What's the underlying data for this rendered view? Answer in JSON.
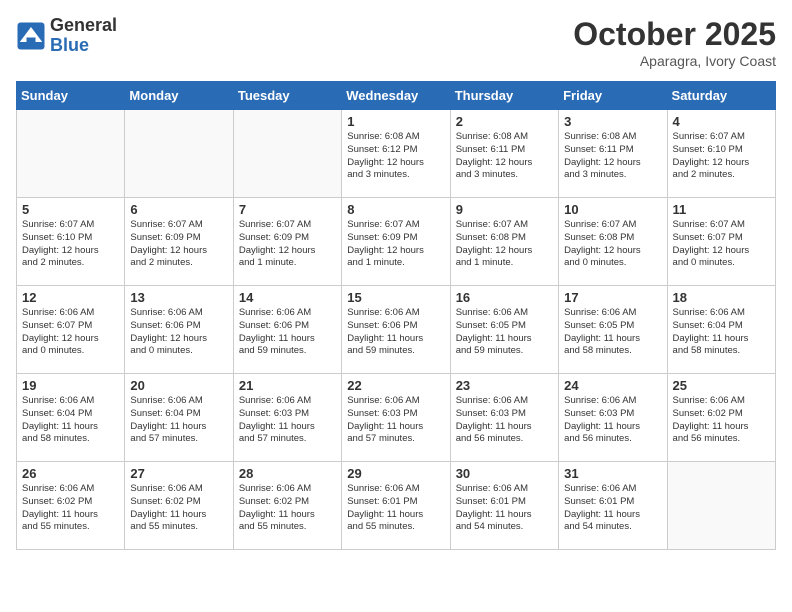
{
  "header": {
    "logo_line1": "General",
    "logo_line2": "Blue",
    "month": "October 2025",
    "location": "Aparagra, Ivory Coast"
  },
  "days_of_week": [
    "Sunday",
    "Monday",
    "Tuesday",
    "Wednesday",
    "Thursday",
    "Friday",
    "Saturday"
  ],
  "weeks": [
    [
      {
        "day": "",
        "info": ""
      },
      {
        "day": "",
        "info": ""
      },
      {
        "day": "",
        "info": ""
      },
      {
        "day": "1",
        "info": "Sunrise: 6:08 AM\nSunset: 6:12 PM\nDaylight: 12 hours\nand 3 minutes."
      },
      {
        "day": "2",
        "info": "Sunrise: 6:08 AM\nSunset: 6:11 PM\nDaylight: 12 hours\nand 3 minutes."
      },
      {
        "day": "3",
        "info": "Sunrise: 6:08 AM\nSunset: 6:11 PM\nDaylight: 12 hours\nand 3 minutes."
      },
      {
        "day": "4",
        "info": "Sunrise: 6:07 AM\nSunset: 6:10 PM\nDaylight: 12 hours\nand 2 minutes."
      }
    ],
    [
      {
        "day": "5",
        "info": "Sunrise: 6:07 AM\nSunset: 6:10 PM\nDaylight: 12 hours\nand 2 minutes."
      },
      {
        "day": "6",
        "info": "Sunrise: 6:07 AM\nSunset: 6:09 PM\nDaylight: 12 hours\nand 2 minutes."
      },
      {
        "day": "7",
        "info": "Sunrise: 6:07 AM\nSunset: 6:09 PM\nDaylight: 12 hours\nand 1 minute."
      },
      {
        "day": "8",
        "info": "Sunrise: 6:07 AM\nSunset: 6:09 PM\nDaylight: 12 hours\nand 1 minute."
      },
      {
        "day": "9",
        "info": "Sunrise: 6:07 AM\nSunset: 6:08 PM\nDaylight: 12 hours\nand 1 minute."
      },
      {
        "day": "10",
        "info": "Sunrise: 6:07 AM\nSunset: 6:08 PM\nDaylight: 12 hours\nand 0 minutes."
      },
      {
        "day": "11",
        "info": "Sunrise: 6:07 AM\nSunset: 6:07 PM\nDaylight: 12 hours\nand 0 minutes."
      }
    ],
    [
      {
        "day": "12",
        "info": "Sunrise: 6:06 AM\nSunset: 6:07 PM\nDaylight: 12 hours\nand 0 minutes."
      },
      {
        "day": "13",
        "info": "Sunrise: 6:06 AM\nSunset: 6:06 PM\nDaylight: 12 hours\nand 0 minutes."
      },
      {
        "day": "14",
        "info": "Sunrise: 6:06 AM\nSunset: 6:06 PM\nDaylight: 11 hours\nand 59 minutes."
      },
      {
        "day": "15",
        "info": "Sunrise: 6:06 AM\nSunset: 6:06 PM\nDaylight: 11 hours\nand 59 minutes."
      },
      {
        "day": "16",
        "info": "Sunrise: 6:06 AM\nSunset: 6:05 PM\nDaylight: 11 hours\nand 59 minutes."
      },
      {
        "day": "17",
        "info": "Sunrise: 6:06 AM\nSunset: 6:05 PM\nDaylight: 11 hours\nand 58 minutes."
      },
      {
        "day": "18",
        "info": "Sunrise: 6:06 AM\nSunset: 6:04 PM\nDaylight: 11 hours\nand 58 minutes."
      }
    ],
    [
      {
        "day": "19",
        "info": "Sunrise: 6:06 AM\nSunset: 6:04 PM\nDaylight: 11 hours\nand 58 minutes."
      },
      {
        "day": "20",
        "info": "Sunrise: 6:06 AM\nSunset: 6:04 PM\nDaylight: 11 hours\nand 57 minutes."
      },
      {
        "day": "21",
        "info": "Sunrise: 6:06 AM\nSunset: 6:03 PM\nDaylight: 11 hours\nand 57 minutes."
      },
      {
        "day": "22",
        "info": "Sunrise: 6:06 AM\nSunset: 6:03 PM\nDaylight: 11 hours\nand 57 minutes."
      },
      {
        "day": "23",
        "info": "Sunrise: 6:06 AM\nSunset: 6:03 PM\nDaylight: 11 hours\nand 56 minutes."
      },
      {
        "day": "24",
        "info": "Sunrise: 6:06 AM\nSunset: 6:03 PM\nDaylight: 11 hours\nand 56 minutes."
      },
      {
        "day": "25",
        "info": "Sunrise: 6:06 AM\nSunset: 6:02 PM\nDaylight: 11 hours\nand 56 minutes."
      }
    ],
    [
      {
        "day": "26",
        "info": "Sunrise: 6:06 AM\nSunset: 6:02 PM\nDaylight: 11 hours\nand 55 minutes."
      },
      {
        "day": "27",
        "info": "Sunrise: 6:06 AM\nSunset: 6:02 PM\nDaylight: 11 hours\nand 55 minutes."
      },
      {
        "day": "28",
        "info": "Sunrise: 6:06 AM\nSunset: 6:02 PM\nDaylight: 11 hours\nand 55 minutes."
      },
      {
        "day": "29",
        "info": "Sunrise: 6:06 AM\nSunset: 6:01 PM\nDaylight: 11 hours\nand 55 minutes."
      },
      {
        "day": "30",
        "info": "Sunrise: 6:06 AM\nSunset: 6:01 PM\nDaylight: 11 hours\nand 54 minutes."
      },
      {
        "day": "31",
        "info": "Sunrise: 6:06 AM\nSunset: 6:01 PM\nDaylight: 11 hours\nand 54 minutes."
      },
      {
        "day": "",
        "info": ""
      }
    ]
  ]
}
